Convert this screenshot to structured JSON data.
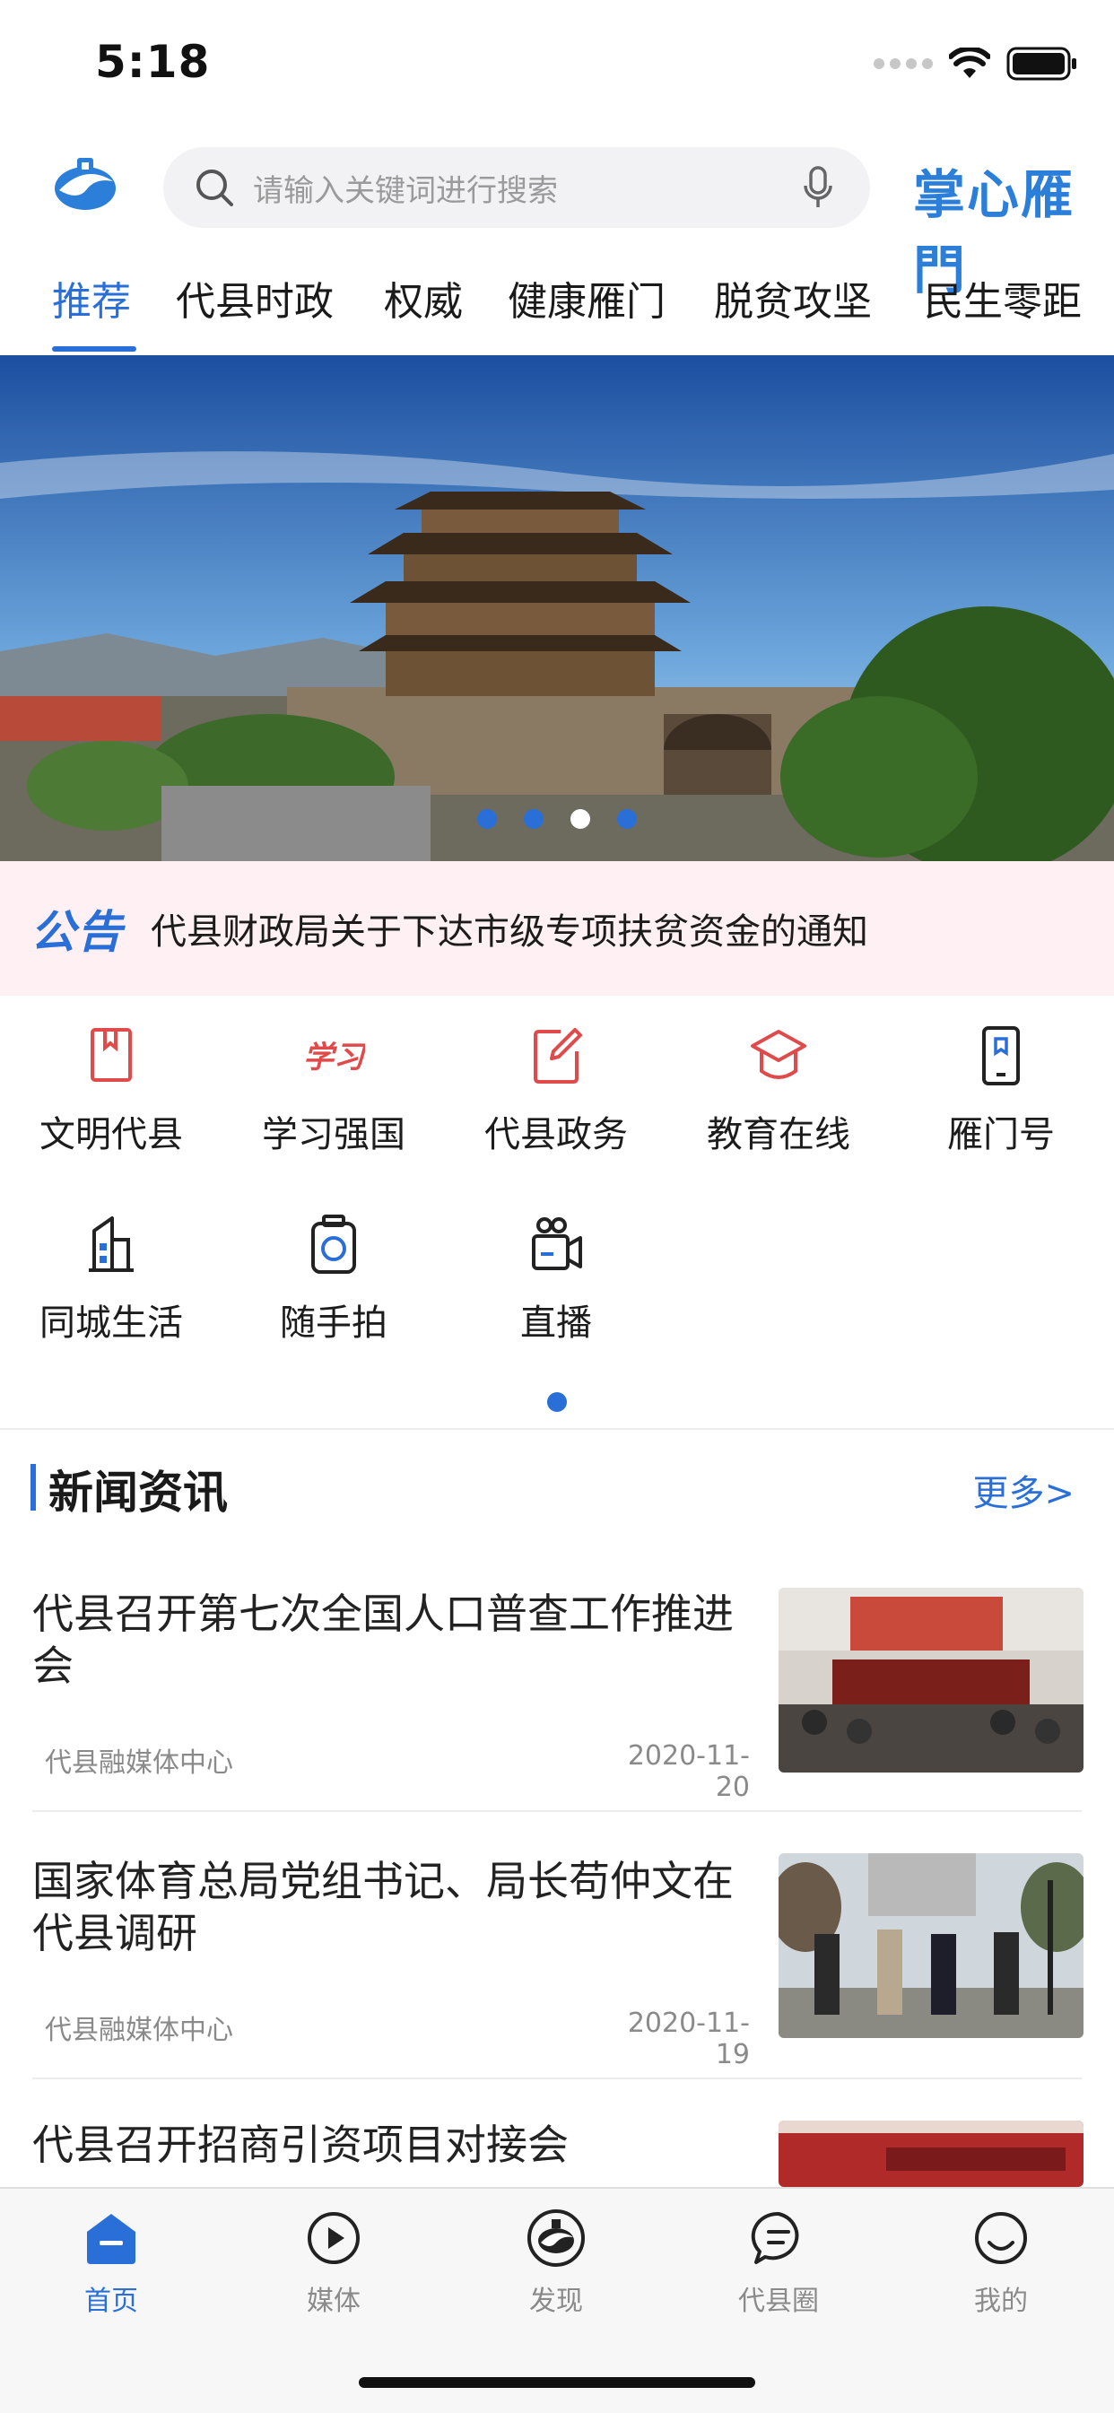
{
  "status": {
    "time": "5:18"
  },
  "header": {
    "search_placeholder": "请输入关键词进行搜索",
    "brand": "掌心雁門"
  },
  "tabs": [
    {
      "label": "推荐",
      "active": true
    },
    {
      "label": "代县时政"
    },
    {
      "label": "权威"
    },
    {
      "label": "健康雁门"
    },
    {
      "label": "脱贫攻坚"
    },
    {
      "label": "民生零距"
    }
  ],
  "banner": {
    "page_count": 4,
    "active_page": 3
  },
  "notice": {
    "tag": "公告",
    "text": "代县财政局关于下达市级专项扶贫资金的通知"
  },
  "functions": [
    {
      "label": "文明代县",
      "icon": "book-icon"
    },
    {
      "label": "学习强国",
      "icon": "xuexi-icon"
    },
    {
      "label": "代县政务",
      "icon": "edit-icon"
    },
    {
      "label": "教育在线",
      "icon": "graduation-cap-icon"
    },
    {
      "label": "雁门号",
      "icon": "bookmark-phone-icon"
    },
    {
      "label": "同城生活",
      "icon": "building-icon"
    },
    {
      "label": "随手拍",
      "icon": "camera-icon"
    },
    {
      "label": "直播",
      "icon": "video-icon"
    }
  ],
  "news": {
    "title": "新闻资讯",
    "more": "更多>",
    "items": [
      {
        "headline": "代县召开第七次全国人口普查工作推进会",
        "source": "代县融媒体中心",
        "date": "2020-11-20"
      },
      {
        "headline": "国家体育总局党组书记、局长苟仲文在代县调研",
        "source": "代县融媒体中心",
        "date": "2020-11-19"
      },
      {
        "headline": "代县召开招商引资项目对接会",
        "source": "",
        "date": ""
      }
    ]
  },
  "tabbar": [
    {
      "label": "首页",
      "icon": "home-icon",
      "active": true
    },
    {
      "label": "媒体",
      "icon": "play-icon"
    },
    {
      "label": "发现",
      "icon": "discover-logo-icon"
    },
    {
      "label": "代县圈",
      "icon": "chat-icon"
    },
    {
      "label": "我的",
      "icon": "smile-icon"
    }
  ],
  "colors": {
    "accent": "#2a6fd8",
    "notice_bg": "#fff1f3",
    "icon_red": "#e04a4a"
  }
}
